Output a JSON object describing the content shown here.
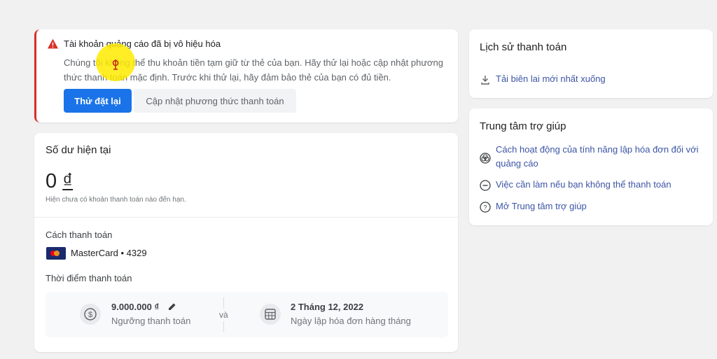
{
  "alert": {
    "title": "Tài khoản quảng cáo đã bị vô hiệu hóa",
    "body": "Chúng tôi không thể thu khoản tiền tạm giữ từ thẻ của bạn. Hãy thử lại hoặc cập nhật phương thức thanh toán mặc định. Trước khi thử lại, hãy đảm bảo thẻ của bạn có đủ tiền.",
    "retry_label": "Thử đặt lại",
    "update_label": "Cập nhật phương thức thanh toán",
    "color": "#d93025"
  },
  "balance": {
    "title": "Số dư hiện tại",
    "amount": "0",
    "currency": "₫",
    "note": "Hiện chưa có khoản thanh toán nào đến hạn.",
    "payment_method_label": "Cách thanh toán",
    "card_name": "MasterCard • 4329",
    "payment_time_label": "Thời điểm thanh toán",
    "threshold_value": "9.000.000 ₫",
    "threshold_caption": "Ngưỡng thanh toán",
    "and_label": "và",
    "billing_date_value": "2 Tháng 12, 2022",
    "billing_date_caption": "Ngày lập hóa đơn hàng tháng"
  },
  "history": {
    "title": "Lịch sử thanh toán",
    "download_link": "Tải biên lai mới nhất xuống"
  },
  "help": {
    "title": "Trung tâm trợ giúp",
    "links": [
      "Cách hoạt động của tính năng lập hóa đơn đối với quảng cáo",
      "Việc cần làm nếu bạn không thể thanh toán",
      "Mở Trung tâm trợ giúp"
    ]
  },
  "icons": [
    "warning-icon",
    "edit-icon",
    "dollar-icon",
    "calendar-icon",
    "download-icon",
    "circles-icon",
    "minus-circle-icon",
    "help-icon",
    "mastercard-logo"
  ]
}
